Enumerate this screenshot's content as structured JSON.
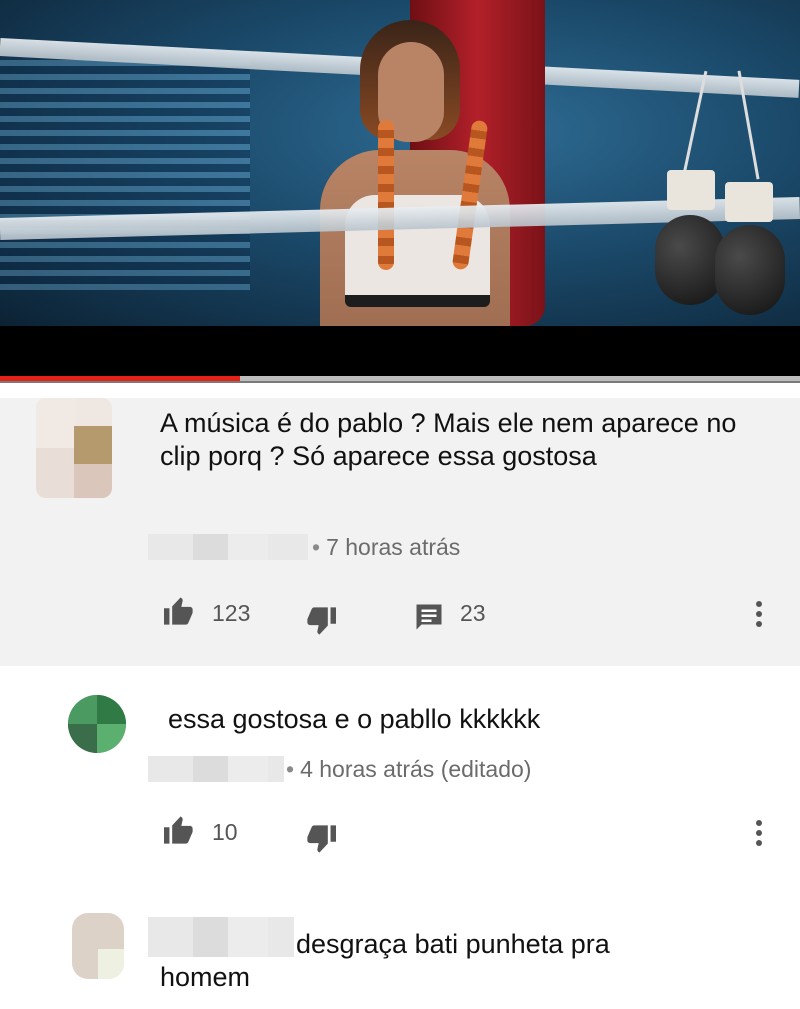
{
  "video": {
    "progress_fraction": 0.3
  },
  "comments": [
    {
      "text": "A música é do pablo ? Mais ele nem aparece no clip porq ?  Só aparece essa gostosa",
      "time": "7 horas atrás",
      "likes": "123",
      "replies": "23"
    },
    {
      "text": "essa gostosa e o pabllo kkkkkk",
      "time": "4 horas atrás (editado)",
      "likes": "10"
    },
    {
      "text_line1": "desgraça bati punheta pra",
      "text_line2": "homem"
    }
  ],
  "icons": {
    "like": "thumbs-up-icon",
    "dislike": "thumbs-down-icon",
    "reply": "reply-comment-icon",
    "menu": "more-vert-icon"
  },
  "colors": {
    "progress": "#e62117",
    "highlight_bg": "#f2f2f2",
    "meta_text": "#6b6b6b"
  }
}
